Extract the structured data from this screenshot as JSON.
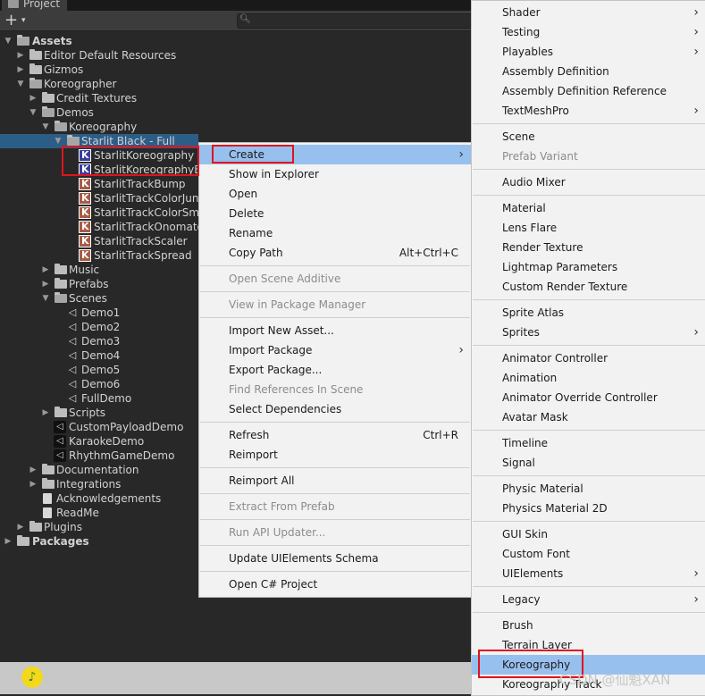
{
  "panel": {
    "tab_label": "Project",
    "add_label": "+",
    "add_caret": "▾"
  },
  "tree": {
    "assets": "Assets",
    "editor_default": "Editor Default Resources",
    "gizmos": "Gizmos",
    "koreographer": "Koreographer",
    "credit_textures": "Credit Textures",
    "demos": "Demos",
    "koreography": "Koreography",
    "starlit_black": "Starlit Black - Full",
    "files": [
      "StarlitKoreography",
      "StarlitKoreographyEx",
      "StarlitTrackBump",
      "StarlitTrackColorJun",
      "StarlitTrackColorSmo",
      "StarlitTrackOnomato",
      "StarlitTrackScaler",
      "StarlitTrackSpread"
    ],
    "music": "Music",
    "prefabs": "Prefabs",
    "scenes": "Scenes",
    "scene_items": [
      "Demo1",
      "Demo2",
      "Demo3",
      "Demo4",
      "Demo5",
      "Demo6",
      "FullDemo"
    ],
    "scripts": "Scripts",
    "demo_scenes": [
      "CustomPayloadDemo",
      "KaraokeDemo",
      "RhythmGameDemo"
    ],
    "documentation": "Documentation",
    "integrations": "Integrations",
    "acknowledgements": "Acknowledgements",
    "readme": "ReadMe",
    "plugins": "Plugins",
    "packages": "Packages"
  },
  "context_menu": [
    {
      "label": "Create",
      "submenu": true,
      "highlighted": true
    },
    {
      "label": "Show in Explorer"
    },
    {
      "label": "Open"
    },
    {
      "label": "Delete"
    },
    {
      "label": "Rename"
    },
    {
      "label": "Copy Path",
      "shortcut": "Alt+Ctrl+C"
    },
    {
      "label": "Open Scene Additive",
      "disabled": true
    },
    {
      "label": "View in Package Manager",
      "disabled": true
    },
    {
      "label": "Import New Asset..."
    },
    {
      "label": "Import Package",
      "submenu": true
    },
    {
      "label": "Export Package..."
    },
    {
      "label": "Find References In Scene",
      "disabled": true
    },
    {
      "label": "Select Dependencies"
    },
    {
      "label": "Refresh",
      "shortcut": "Ctrl+R"
    },
    {
      "label": "Reimport"
    },
    {
      "label": "Reimport All"
    },
    {
      "label": "Extract From Prefab",
      "disabled": true
    },
    {
      "label": "Run API Updater...",
      "disabled": true
    },
    {
      "label": "Update UIElements Schema"
    },
    {
      "label": "Open C# Project"
    }
  ],
  "create_submenu": [
    {
      "label": "Shader",
      "submenu": true
    },
    {
      "label": "Testing",
      "submenu": true
    },
    {
      "label": "Playables",
      "submenu": true
    },
    {
      "label": "Assembly Definition"
    },
    {
      "label": "Assembly Definition Reference"
    },
    {
      "label": "TextMeshPro",
      "submenu": true
    },
    {
      "label": "Scene"
    },
    {
      "label": "Prefab Variant",
      "disabled": true
    },
    {
      "label": "Audio Mixer"
    },
    {
      "label": "Material"
    },
    {
      "label": "Lens Flare"
    },
    {
      "label": "Render Texture"
    },
    {
      "label": "Lightmap Parameters"
    },
    {
      "label": "Custom Render Texture"
    },
    {
      "label": "Sprite Atlas"
    },
    {
      "label": "Sprites",
      "submenu": true
    },
    {
      "label": "Animator Controller"
    },
    {
      "label": "Animation"
    },
    {
      "label": "Animator Override Controller"
    },
    {
      "label": "Avatar Mask"
    },
    {
      "label": "Timeline"
    },
    {
      "label": "Signal"
    },
    {
      "label": "Physic Material"
    },
    {
      "label": "Physics Material 2D"
    },
    {
      "label": "GUI Skin"
    },
    {
      "label": "Custom Font"
    },
    {
      "label": "UIElements",
      "submenu": true
    },
    {
      "label": "Legacy",
      "submenu": true
    },
    {
      "label": "Brush"
    },
    {
      "label": "Terrain Layer"
    },
    {
      "label": "Koreography",
      "highlighted": true
    },
    {
      "label": "Koreography Track"
    }
  ],
  "watermark": "CSDN @仙魁XAN",
  "colors": {
    "highlight": "#98c0ee",
    "selection": "#2c5d87",
    "annotation": "#e0141e"
  }
}
